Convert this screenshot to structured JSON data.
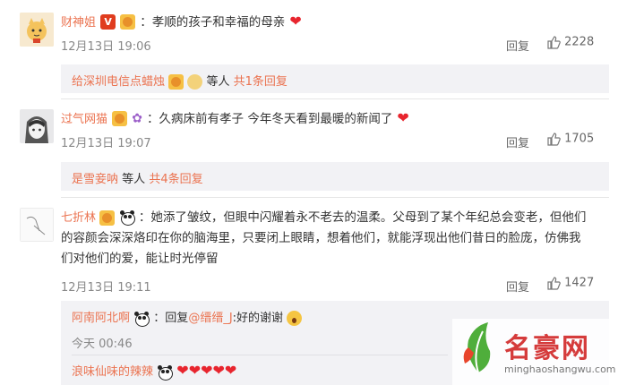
{
  "comments": [
    {
      "username": "财神姐",
      "text": "：孝顺的孩子和幸福的母亲",
      "time": "12月13日 19:06",
      "reply_label": "回复",
      "likes": "2228",
      "sub_summary": {
        "names": "给深圳电信点蜡烛",
        "others": "等人",
        "count_text": "共1条回复"
      }
    },
    {
      "username": "过气网猫",
      "text": "：久病床前有孝子 今年冬天看到最暖的新闻了",
      "time": "12月13日 19:07",
      "reply_label": "回复",
      "likes": "1705",
      "sub_summary": {
        "names": "是雪妾呐",
        "others": "等人",
        "count_text": "共4条回复"
      }
    },
    {
      "username": "七折林",
      "text_line1": "：她添了皱纹，但眼中闪耀着永不老去的温柔。父母到了某个年纪总会变老，但他们",
      "text_line2": "的容颜会深深烙印在你的脑海里，只要闭上眼睛，想着他们，就能浮现出他们昔日的脸庞，仿佛我",
      "text_line3": "们对他们的爱，能让时光停留",
      "time": "12月13日 19:11",
      "reply_label": "回复",
      "likes": "1427"
    }
  ],
  "replies": [
    {
      "username": "阿南阿北啊",
      "text_prefix": "：回复",
      "mention": "@缙缙_J",
      "text_suffix": ":好的谢谢",
      "time": "今天 00:46"
    },
    {
      "username": "浪味仙味的辣辣"
    }
  ],
  "watermark": {
    "brand": "名豪网",
    "url": "minghaoshangwu.com"
  },
  "colors": {
    "username": "#eb7350",
    "heart": "#e8252e",
    "strip_bg": "#f2f2f5"
  }
}
